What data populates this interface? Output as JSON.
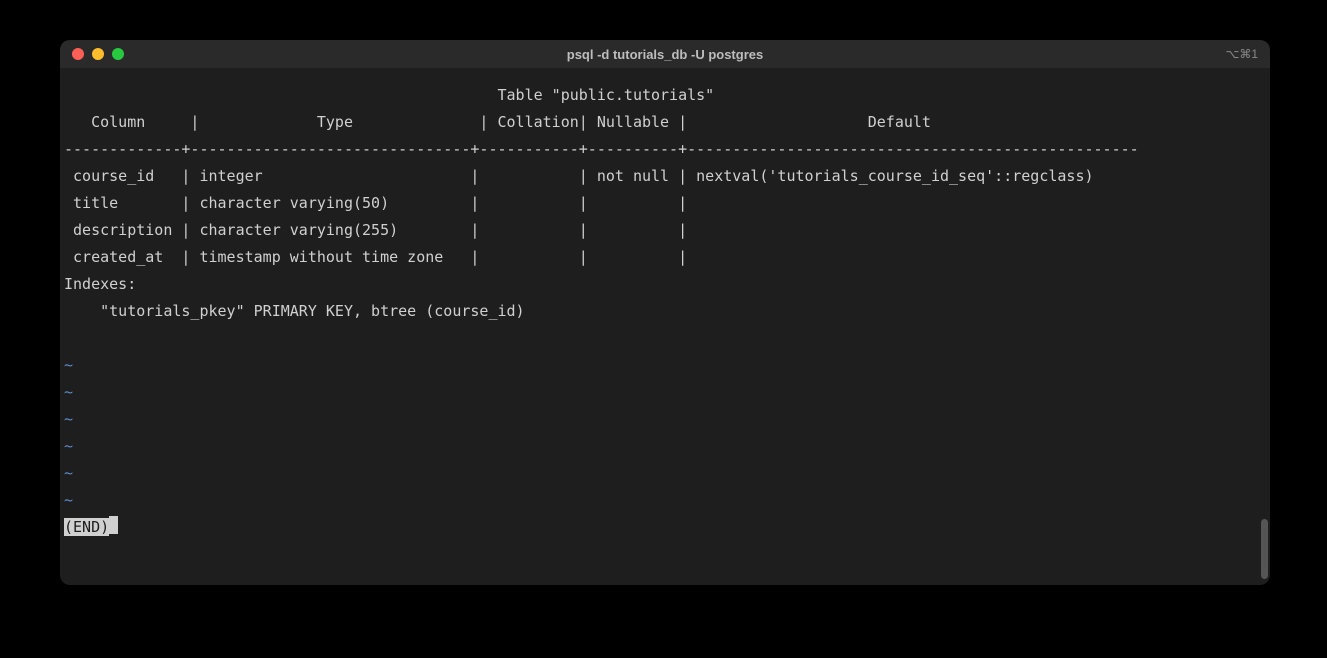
{
  "window": {
    "title": "psql -d tutorials_db -U postgres",
    "right_hint": "⌥⌘1"
  },
  "terminal": {
    "table_heading": "Table \"public.tutorials\"",
    "headers": {
      "column": "Column",
      "type": "Type",
      "collation": "Collation",
      "nullable": "Nullable",
      "default": "Default"
    },
    "rows": [
      {
        "column": "course_id",
        "type": "integer",
        "collation": "",
        "nullable": "not null",
        "default": "nextval('tutorials_course_id_seq'::regclass)"
      },
      {
        "column": "title",
        "type": "character varying(50)",
        "collation": "",
        "nullable": "",
        "default": ""
      },
      {
        "column": "description",
        "type": "character varying(255)",
        "collation": "",
        "nullable": "",
        "default": ""
      },
      {
        "column": "created_at",
        "type": "timestamp without time zone",
        "collation": "",
        "nullable": "",
        "default": ""
      }
    ],
    "indexes_label": "Indexes:",
    "indexes_line": "    \"tutorials_pkey\" PRIMARY KEY, btree (course_id)",
    "tilde": "~",
    "end_marker": "(END)"
  }
}
